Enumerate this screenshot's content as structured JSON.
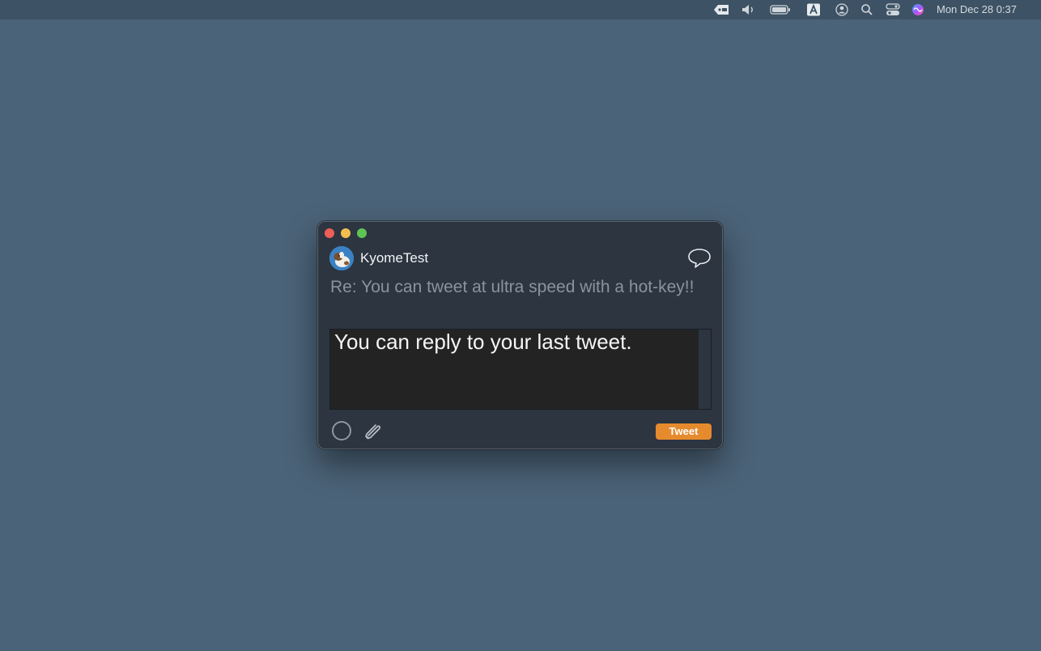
{
  "menubar": {
    "icons": [
      "tag-icon",
      "volume-icon",
      "battery-icon",
      "input-source-icon",
      "user-icon",
      "search-icon",
      "control-center-icon",
      "siri-icon"
    ],
    "clock": "Mon Dec 28  0:37"
  },
  "window": {
    "username": "KyomeTest",
    "reply_to": "Re: You can tweet at ultra speed with a hot-key!!",
    "compose_text": "You can reply to your last tweet.",
    "tweet_label": "Tweet"
  },
  "colors": {
    "desktop": "#4b6378",
    "window": "#2c3540",
    "editor": "#232323",
    "accent": "#e68a2e"
  }
}
